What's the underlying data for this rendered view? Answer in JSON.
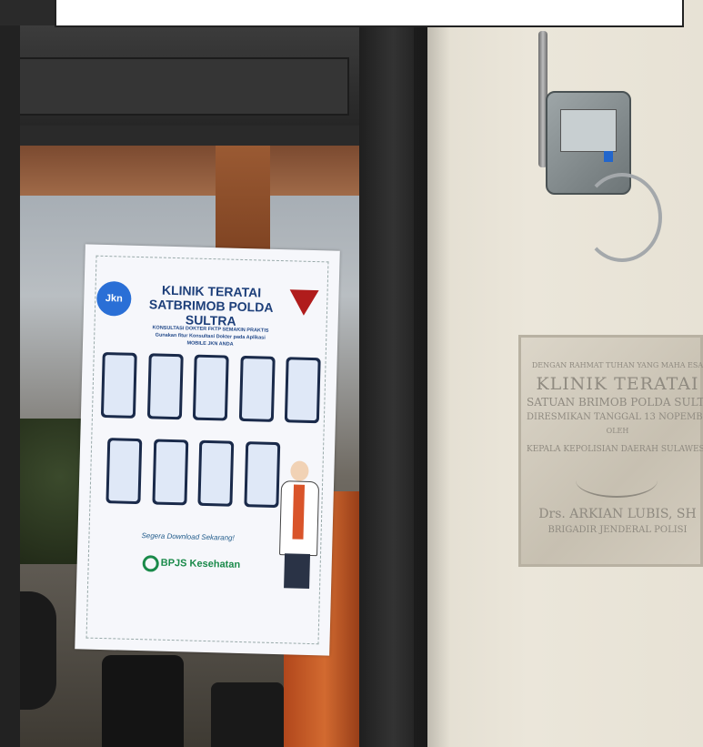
{
  "poster": {
    "logo_left": "Jkn",
    "title_line1": "KLINIK TERATAI",
    "title_line2": "SATBRIMOB POLDA SULTRA",
    "subtitle_line1": "KONSULTASI DOKTER FKTP SEMAKIN PRAKTIS",
    "subtitle_line2": "Gunakan fitur Konsultasi Dokter pada Aplikasi",
    "subtitle_line3": "MOBILE JKN ANDA",
    "download_text": "Segera Download Sekarang!",
    "bpjs_brand": "BPJS Kesehatan"
  },
  "plaque": {
    "line1": "DENGAN RAHMAT TUHAN YANG MAHA ESA",
    "line2": "KLINIK TERATAI",
    "line3": "SATUAN BRIMOB POLDA SULTRA",
    "line4": "DIRESMIKAN TANGGAL 13 NOPEMBER",
    "line5": "OLEH",
    "line6": "KEPALA KEPOLISIAN DAERAH SULAWESI TENGGARA",
    "line7": "Drs. ARKIAN LUBIS, SH",
    "line8": "BRIGADIR JENDERAL POLISI"
  }
}
